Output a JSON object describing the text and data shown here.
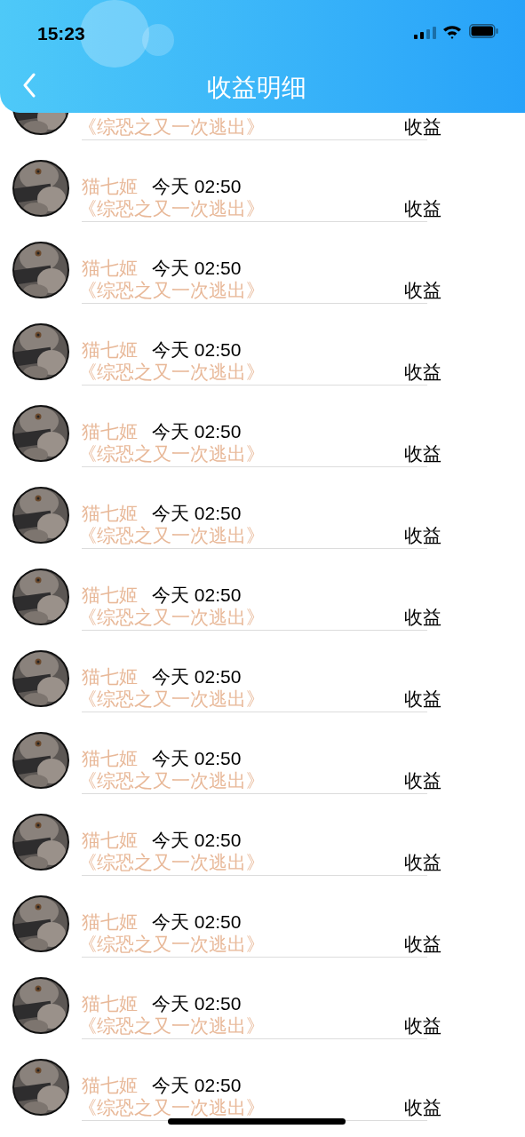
{
  "status_bar": {
    "time": "15:23"
  },
  "header": {
    "title": "收益明细"
  },
  "records": [
    {
      "title": "《综恐之又一次逃出》",
      "income_label": "收益"
    },
    {
      "name": "猫七姬",
      "time": "今天 02:50",
      "title": "《综恐之又一次逃出》",
      "income_label": "收益"
    },
    {
      "name": "猫七姬",
      "time": "今天 02:50",
      "title": "《综恐之又一次逃出》",
      "income_label": "收益"
    },
    {
      "name": "猫七姬",
      "time": "今天 02:50",
      "title": "《综恐之又一次逃出》",
      "income_label": "收益"
    },
    {
      "name": "猫七姬",
      "time": "今天 02:50",
      "title": "《综恐之又一次逃出》",
      "income_label": "收益"
    },
    {
      "name": "猫七姬",
      "time": "今天 02:50",
      "title": "《综恐之又一次逃出》",
      "income_label": "收益"
    },
    {
      "name": "猫七姬",
      "time": "今天 02:50",
      "title": "《综恐之又一次逃出》",
      "income_label": "收益"
    },
    {
      "name": "猫七姬",
      "time": "今天 02:50",
      "title": "《综恐之又一次逃出》",
      "income_label": "收益"
    },
    {
      "name": "猫七姬",
      "time": "今天 02:50",
      "title": "《综恐之又一次逃出》",
      "income_label": "收益"
    },
    {
      "name": "猫七姬",
      "time": "今天 02:50",
      "title": "《综恐之又一次逃出》",
      "income_label": "收益"
    },
    {
      "name": "猫七姬",
      "time": "今天 02:50",
      "title": "《综恐之又一次逃出》",
      "income_label": "收益"
    },
    {
      "name": "猫七姬",
      "time": "今天 02:50",
      "title": "《综恐之又一次逃出》",
      "income_label": "收益"
    },
    {
      "name": "猫七姬",
      "time": "今天 02:50",
      "title": "《综恐之又一次逃出》",
      "income_label": "收益"
    }
  ]
}
